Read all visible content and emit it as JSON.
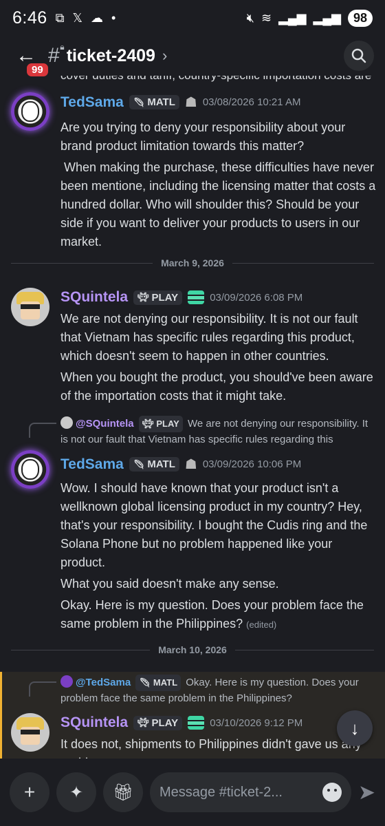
{
  "status_bar": {
    "time": "6:46",
    "battery": "98",
    "left_icons": [
      "screenshot-icon",
      "x-icon",
      "weather-icon",
      "dot-icon"
    ],
    "right_icons": [
      "mute-icon",
      "wifi-icon",
      "signal-icon",
      "signal-icon"
    ]
  },
  "header": {
    "back_badge": "99",
    "channel_name": "ticket-2409"
  },
  "messages": {
    "clipped_top_line": "cover duties and tariff, country-specific importation costs are",
    "m1": {
      "author": "TedSama",
      "tag": "MATL",
      "timestamp": "03/08/2026 10:21 AM",
      "lines": [
        "Are you trying to deny your responsibility about your brand product limitation towards this matter?",
        " When making the purchase, these difficulties have never been mentione, including the licensing matter that costs a hundred dollar. Who will shoulder this? Should be your side if you want to deliver your products to users in our market."
      ]
    },
    "divider1": "March 9, 2026",
    "m2": {
      "author": "SQuintela",
      "tag": "PLAY",
      "timestamp": "03/09/2026 6:08 PM",
      "lines": [
        "We are not denying our responsibility. It is not our fault that Vietnam has specific rules regarding this product, which doesn't seem to happen in other countries.",
        "When you bought the product, you should've been aware of the importation costs that it might take."
      ]
    },
    "m3": {
      "reply_author": "@SQuintela",
      "reply_tag": "PLAY",
      "reply_text": "We are not denying our responsibility. It is not our fault that Vietnam has specific rules regarding this",
      "author": "TedSama",
      "tag": "MATL",
      "timestamp": "03/09/2026 10:06 PM",
      "lines": [
        "Wow. I should have known that your product isn't a wellknown global licensing product in my country? Hey, that's your responsibility. I bought the Cudis ring and the Solana Phone but no problem happened like your product.",
        "What you said doesn't make any sense.",
        "Okay. Here is my question. Does your problem face the same problem in the Philippines?"
      ],
      "edited": "(edited)"
    },
    "divider2": "March 10, 2026",
    "m4": {
      "reply_author": "@TedSama",
      "reply_tag": "MATL",
      "reply_text": "Okay. Here is my question. Does your problem face the same problem in the Philippines?",
      "author": "SQuintela",
      "tag": "PLAY",
      "timestamp": "03/10/2026 9:12 PM",
      "lines": [
        "It does not, shipments to Philippines didn't gave us any problems."
      ]
    }
  },
  "composer": {
    "placeholder": "Message #ticket-2..."
  },
  "colors": {
    "background": "#1c1d22",
    "tedsama_name": "#5ea8e8",
    "squintela_name": "#b694f5",
    "highlight_bar": "#f0b232"
  }
}
